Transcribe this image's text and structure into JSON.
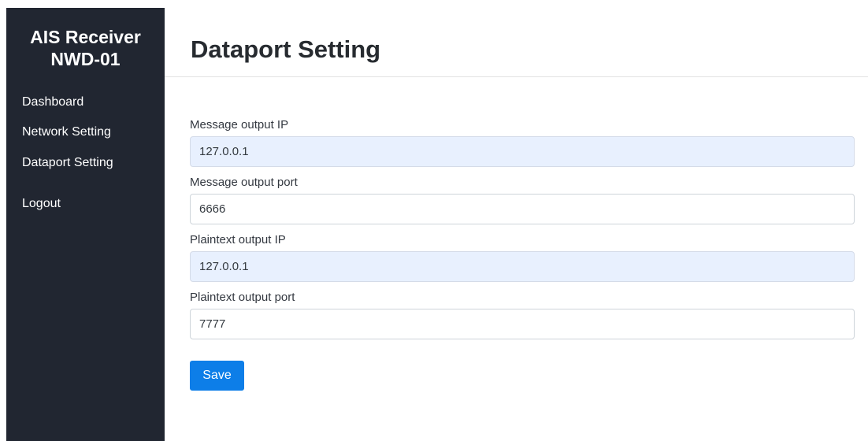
{
  "sidebar": {
    "brand_line1": "AIS Receiver",
    "brand_line2": "NWD-01",
    "items": [
      {
        "label": "Dashboard"
      },
      {
        "label": "Network Setting"
      },
      {
        "label": "Dataport Setting"
      },
      {
        "label": "Logout"
      }
    ]
  },
  "header": {
    "title": "Dataport Setting"
  },
  "form": {
    "fields": [
      {
        "label": "Message output IP",
        "value": "127.0.0.1"
      },
      {
        "label": "Message output port",
        "value": "6666"
      },
      {
        "label": "Plaintext output IP",
        "value": "127.0.0.1"
      },
      {
        "label": "Plaintext output port",
        "value": "7777"
      }
    ],
    "save_label": "Save"
  },
  "colors": {
    "sidebar_bg": "#212631",
    "primary": "#0d7ee8",
    "autofill_bg": "#e8f0fe"
  }
}
